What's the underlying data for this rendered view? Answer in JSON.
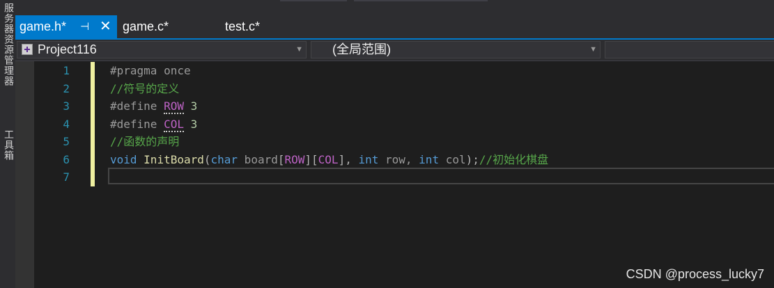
{
  "side_dock": {
    "labels": [
      "服务器资源管理器",
      "工具箱"
    ]
  },
  "tabs": [
    {
      "label": "game.h*",
      "active": true,
      "icons": [
        "pin-icon",
        "close-icon"
      ]
    },
    {
      "label": "game.c*",
      "active": false
    },
    {
      "label": "test.c*",
      "active": false
    }
  ],
  "navbar": {
    "project": "Project116",
    "scope": "(全局范围)",
    "member": ""
  },
  "editor": {
    "line_numbers": [
      "1",
      "2",
      "3",
      "4",
      "5",
      "6",
      "7"
    ],
    "lines": [
      [
        {
          "t": "#pragma once",
          "c": "#9b9b9b"
        }
      ],
      [
        {
          "t": "//符号的定义",
          "c": "#57a64a"
        }
      ],
      [
        {
          "t": "#define ",
          "c": "#9b9b9b"
        },
        {
          "t": "ROW",
          "c": "#bd63c5",
          "dots": true
        },
        {
          "t": " 3",
          "c": "#b5cea8"
        }
      ],
      [
        {
          "t": "#define ",
          "c": "#9b9b9b"
        },
        {
          "t": "COL",
          "c": "#bd63c5",
          "dots": true
        },
        {
          "t": " 3",
          "c": "#b5cea8"
        }
      ],
      [
        {
          "t": "//函数的声明",
          "c": "#57a64a"
        }
      ],
      [
        {
          "t": "void",
          "c": "#569cd6"
        },
        {
          "t": " ",
          "c": "#dcdcdc"
        },
        {
          "t": "InitBoard",
          "c": "#dcdcaa"
        },
        {
          "t": "(",
          "c": "#b4b4b4"
        },
        {
          "t": "char",
          "c": "#569cd6"
        },
        {
          "t": " board",
          "c": "#9a9a9a"
        },
        {
          "t": "[",
          "c": "#b4b4b4"
        },
        {
          "t": "ROW",
          "c": "#bd63c5"
        },
        {
          "t": "][",
          "c": "#b4b4b4"
        },
        {
          "t": "COL",
          "c": "#bd63c5"
        },
        {
          "t": "], ",
          "c": "#b4b4b4"
        },
        {
          "t": "int",
          "c": "#569cd6"
        },
        {
          "t": " row, ",
          "c": "#9a9a9a"
        },
        {
          "t": "int",
          "c": "#569cd6"
        },
        {
          "t": " col",
          "c": "#9a9a9a"
        },
        {
          "t": ");",
          "c": "#b4b4b4"
        },
        {
          "t": "//初始化棋盘",
          "c": "#57a64a"
        }
      ],
      []
    ],
    "current_line": 7
  },
  "colors": {
    "accent": "#007acc",
    "line_number": "#2b91af",
    "change_bar": "#eff0a0",
    "background": "#1e1e1e"
  },
  "watermark": "CSDN @process_lucky7"
}
